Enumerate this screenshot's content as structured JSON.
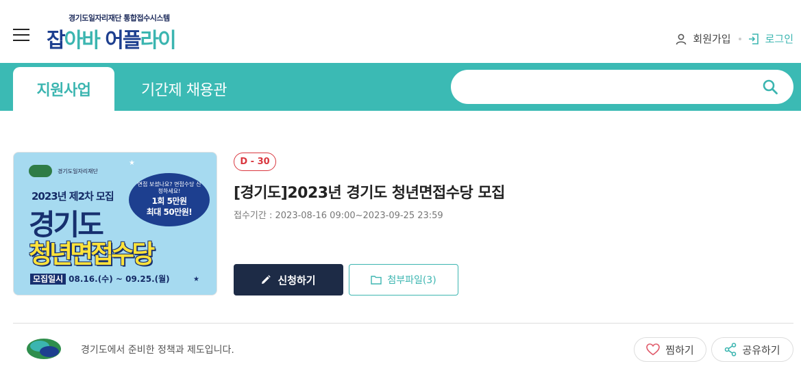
{
  "header": {
    "logo_subtitle": "경기도일자리재단 통합접수시스템",
    "logo_part1": "잡",
    "logo_part2": "아바 ",
    "logo_part3": "어플",
    "logo_part4": "라이",
    "signup_label": "회원가입",
    "login_label": "로그인"
  },
  "nav": {
    "tabs": [
      {
        "label": "지원사업",
        "active": true
      },
      {
        "label": "기간제 채용관",
        "active": false
      }
    ],
    "search_value": ""
  },
  "program": {
    "dday": "D - 30",
    "title": "[경기도]2023년 경기도 청년면접수당 모집",
    "period_label": "접수기간 :",
    "period_value": "2023-08-16 09:00~2023-09-25 23:59",
    "apply_label": "신청하기",
    "files_label": "첨부파일(3)"
  },
  "poster": {
    "org_text": "경기도일자리재단",
    "round": "2023년 제2차 모집",
    "title1": "경기도",
    "title2": "청년면접수당",
    "bubble_small": "면접 보셨나요? 면접수당 신청하세요!",
    "bubble_line1": "1회 5만원",
    "bubble_line2": "최대 50만원!",
    "period_tag": "모집일시",
    "period_text": "08.16.(수) ~ 09.25.(월)"
  },
  "footer": {
    "org_description": "경기도에서 준비한 정책과 제도입니다.",
    "like_label": "찜하기",
    "share_label": "공유하기"
  },
  "colors": {
    "teal": "#3bbab4",
    "navy": "#1d2b46",
    "dday_red": "#d9363e"
  }
}
